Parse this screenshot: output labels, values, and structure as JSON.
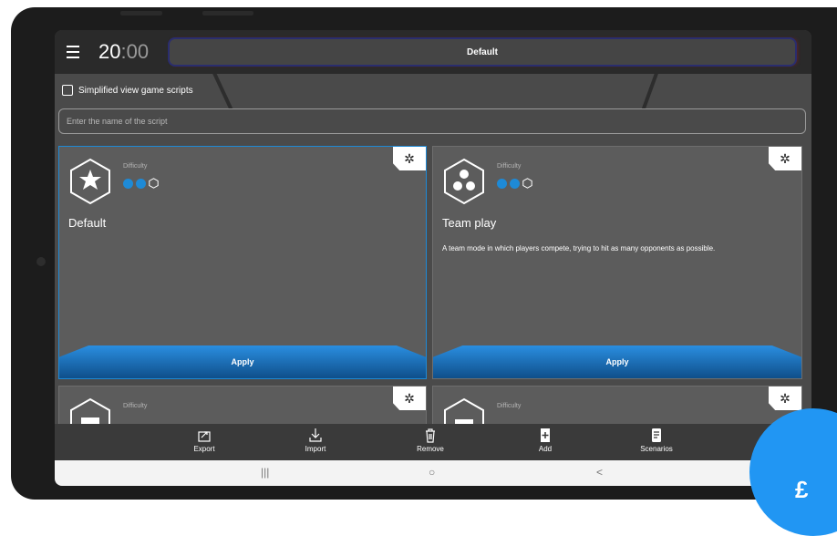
{
  "header": {
    "timer_main": "20",
    "timer_dim": ":00",
    "preset_name": "Default"
  },
  "options": {
    "simplified_view_label": "Simplified view game scripts"
  },
  "search": {
    "placeholder": "Enter the name of the script"
  },
  "cards": [
    {
      "difficulty_label": "Difficulty",
      "title": "Default",
      "description": "",
      "apply_label": "Apply",
      "icon": "star-icon",
      "difficulty_level": 2,
      "difficulty_max": 3
    },
    {
      "difficulty_label": "Difficulty",
      "title": "Team play",
      "description": "A team mode in which players compete, trying to hit as many opponents as possible.",
      "apply_label": "Apply",
      "icon": "skulls-icon",
      "difficulty_level": 2,
      "difficulty_max": 3
    },
    {
      "difficulty_label": "Difficulty",
      "icon": "castle-icon"
    },
    {
      "difficulty_label": "Difficulty",
      "icon": "folder-icon"
    }
  ],
  "toolbar": {
    "export_label": "Export",
    "import_label": "Import",
    "remove_label": "Remove",
    "add_label": "Add",
    "scenarios_label": "Scenarios"
  },
  "system_nav": {
    "recents": "|||",
    "home": "○",
    "back": "<"
  },
  "overlay_glyph": "£",
  "colors": {
    "accent": "#1e8ad6",
    "background": "#4a4a4a",
    "topbar": "#2a2a2a",
    "card": "#5c5c5c"
  }
}
